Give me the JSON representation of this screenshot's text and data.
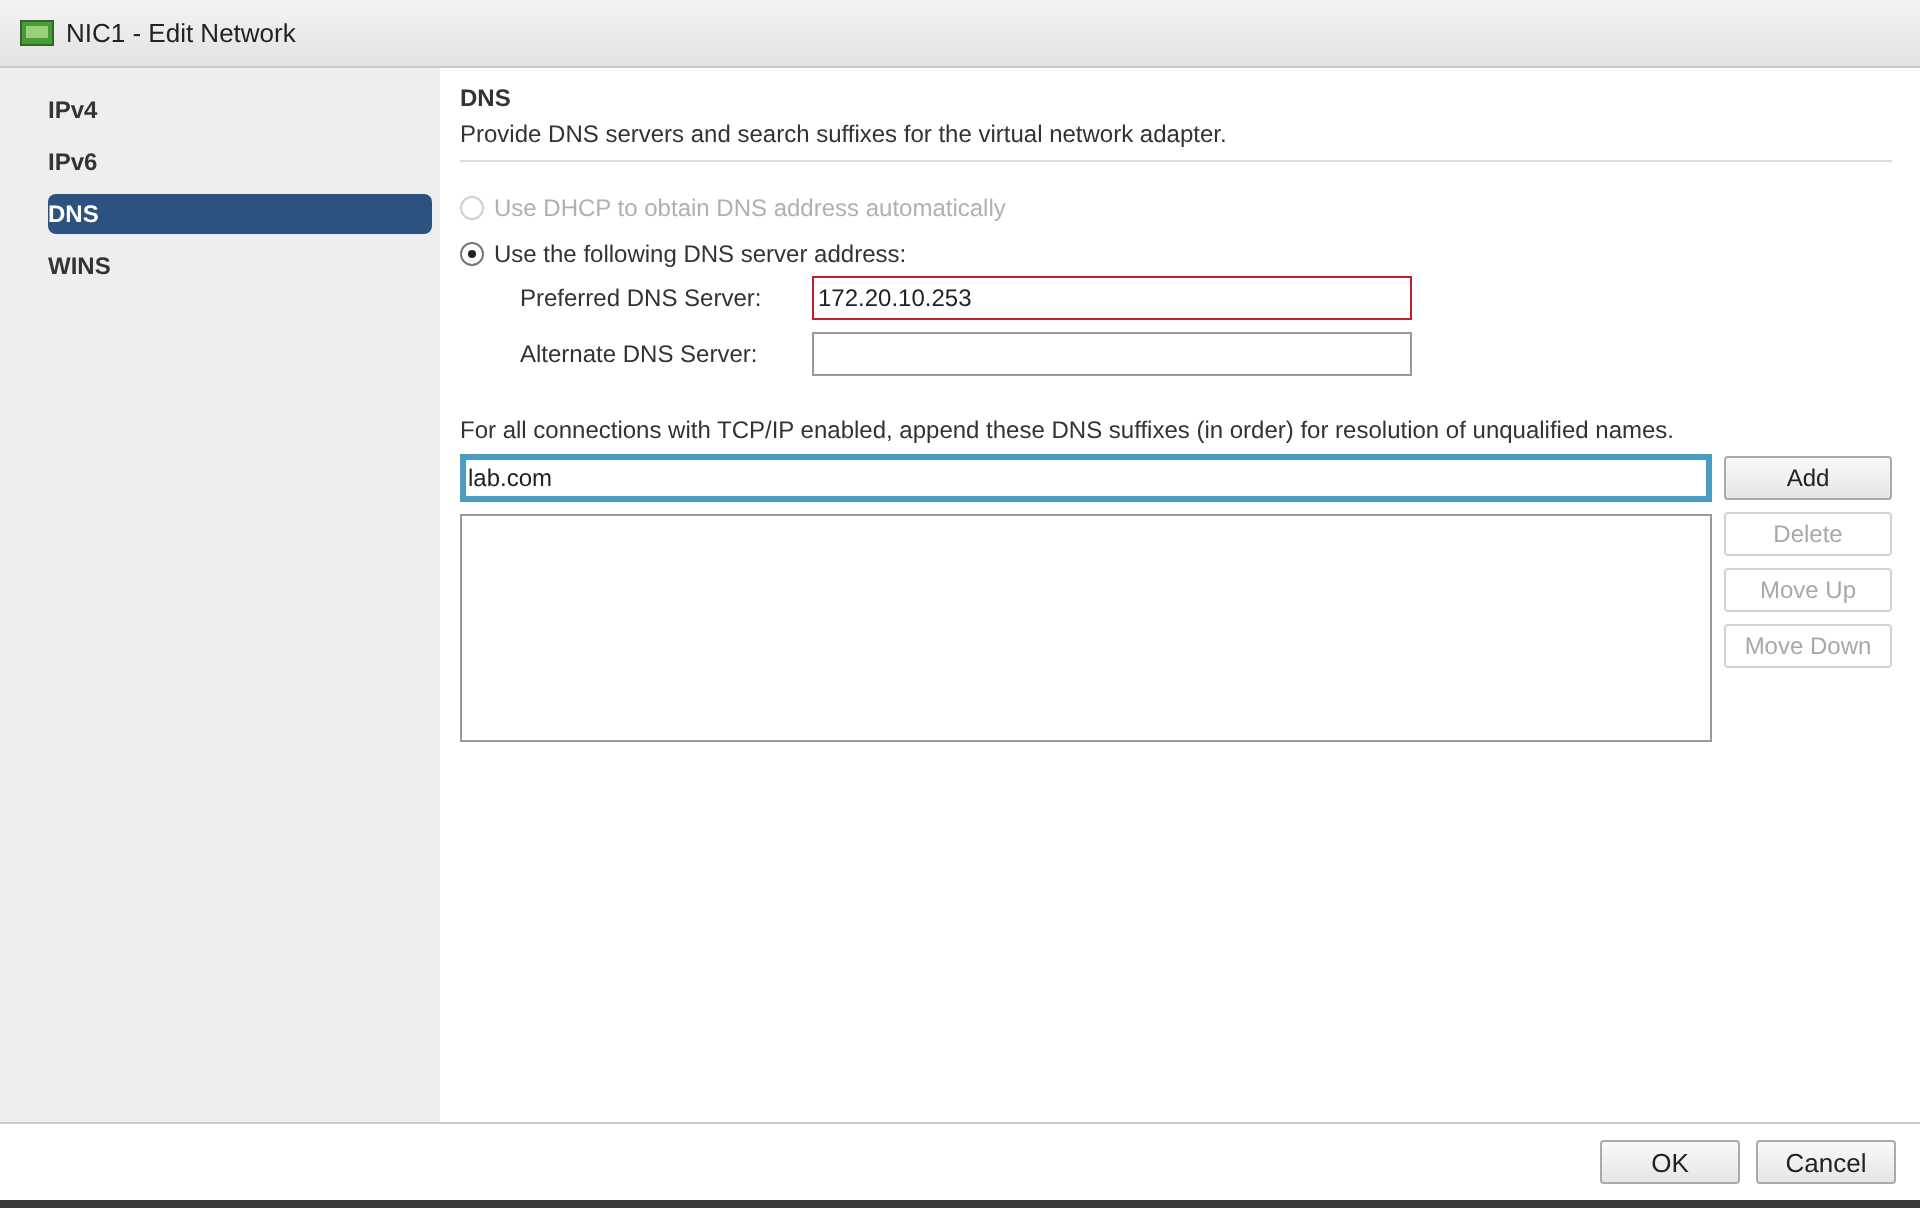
{
  "window": {
    "title": "NIC1 - Edit Network"
  },
  "sidebar": {
    "items": [
      {
        "label": "IPv4",
        "selected": false
      },
      {
        "label": "IPv6",
        "selected": false
      },
      {
        "label": "DNS",
        "selected": true
      },
      {
        "label": "WINS",
        "selected": false
      }
    ]
  },
  "section": {
    "title": "DNS",
    "description": "Provide DNS servers and search suffixes for the virtual network adapter."
  },
  "dns_options": [
    {
      "label": "Use DHCP to obtain DNS address automatically",
      "selected": false,
      "disabled": true
    },
    {
      "label": "Use the following DNS server address:",
      "selected": true,
      "disabled": false
    }
  ],
  "dns_servers": [
    {
      "label": "Preferred DNS Server:",
      "value": "172.20.10.253",
      "error": true
    },
    {
      "label": "Alternate DNS Server:",
      "error": false
    }
  ],
  "suffixes": {
    "instruction": "For all connections with TCP/IP enabled, append these DNS suffixes (in order) for resolution of unqualified names.",
    "input": {
      "value": "lab.com",
      "focused": true
    },
    "buttons": [
      {
        "label": "Add",
        "disabled": false
      },
      {
        "label": "Delete",
        "disabled": true
      },
      {
        "label": "Move Up",
        "disabled": true
      },
      {
        "label": "Move Down",
        "disabled": true
      }
    ]
  },
  "footer": {
    "buttons": [
      {
        "label": "OK"
      },
      {
        "label": "Cancel"
      }
    ]
  }
}
